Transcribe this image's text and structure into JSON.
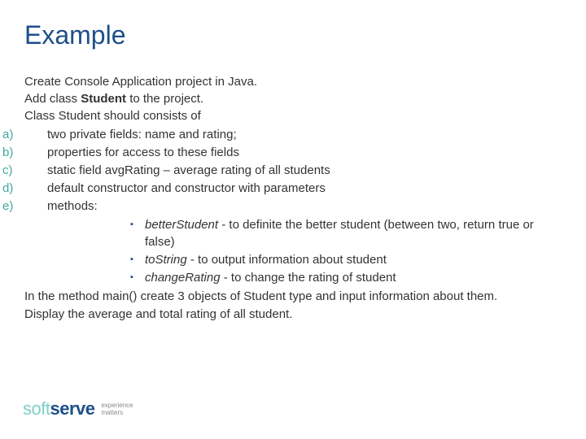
{
  "title": "Example",
  "intro": {
    "line1": "Create Console Application project in Java.",
    "line2_pre": "Add class ",
    "line2_bold": "Student",
    "line2_post": " to the project.",
    "line3": "Class Student should consists of"
  },
  "items": {
    "a": {
      "marker": "a)",
      "text": "two private fields: name and rating;"
    },
    "b": {
      "marker": "b)",
      "text": "properties for access to these fields"
    },
    "c": {
      "marker": "c)",
      "text": "static field avgRating – average rating of all students"
    },
    "d": {
      "marker": "d)",
      "text": "default constructor and constructor with parameters"
    },
    "e": {
      "marker": "e)",
      "text": "methods:"
    }
  },
  "methods": {
    "m1": {
      "name": "betterStudent",
      "desc": " - to definite the better student (between two, return true or false)"
    },
    "m2": {
      "name": "toString",
      "desc": " - to output information about student"
    },
    "m3": {
      "name": "changeRating",
      "desc": " - to change the rating of student"
    }
  },
  "closing": {
    "line1": "In the method main() create 3 objects of Student type and input information about them.",
    "line2": "Display the average and total rating of all student."
  },
  "logo": {
    "soft": "soft",
    "serve": "serve",
    "tag1": "experience",
    "tag2": "matters"
  },
  "bullet": "▪"
}
